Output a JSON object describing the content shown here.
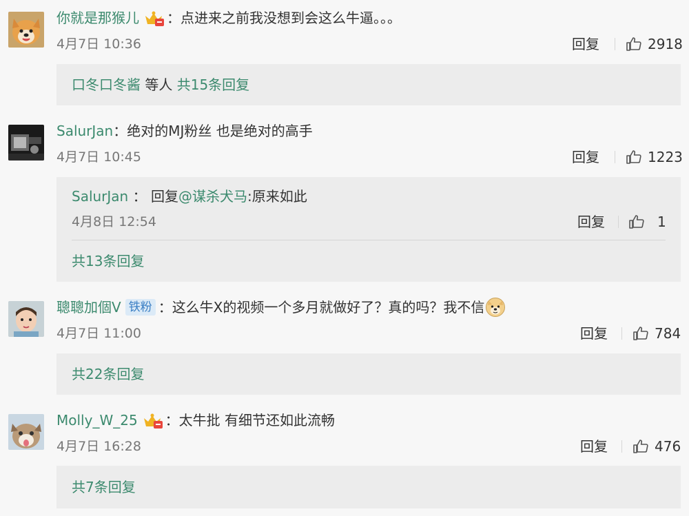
{
  "comments": [
    {
      "username": "你就是那猴儿",
      "text": "点进来之前我没想到会这么牛逼。。。",
      "time": "4月7日 10:36",
      "reply_label": "回复",
      "likes": "2918",
      "badge_icon": "vip-crown-icon",
      "replies": {
        "name_link": "口冬口冬酱",
        "others": "等人",
        "count_link": "共15条回复"
      }
    },
    {
      "username": "SalurJan",
      "text": "绝对的MJ粉丝 也是绝对的高手",
      "time": "4月7日 10:45",
      "reply_label": "回复",
      "likes": "1223",
      "nested_reply": {
        "username": "SalurJan",
        "reply_prefix": "回复",
        "mention": "@谋杀犬马",
        "text": ":原来如此",
        "time": "4月8日 12:54",
        "reply_label": "回复",
        "likes": "1"
      },
      "replies": {
        "count_link": "共13条回复"
      }
    },
    {
      "username": "聰聰加個V",
      "badge": "铁粉",
      "text": "这么牛X的视频一个多月就做好了？真的吗？我不信",
      "emoji_icon": "doge-emoji-icon",
      "time": "4月7日 11:00",
      "reply_label": "回复",
      "likes": "784",
      "replies": {
        "count_link": "共22条回复"
      }
    },
    {
      "username": "Molly_W_25",
      "text": "太牛批 有细节还如此流畅",
      "time": "4月7日 16:28",
      "reply_label": "回复",
      "likes": "476",
      "badge_icon": "vip-crown-icon",
      "replies": {
        "count_link": "共7条回复"
      }
    }
  ],
  "colon": "：",
  "colors": {
    "link_green": "#3c8a6e",
    "background": "#f7f7f7",
    "reply_box": "#ececec",
    "fan_badge_bg": "#dbeaf7",
    "fan_badge_text": "#3b7fc4",
    "crown_gold": "#f0b323",
    "crown_red": "#e8453c"
  }
}
